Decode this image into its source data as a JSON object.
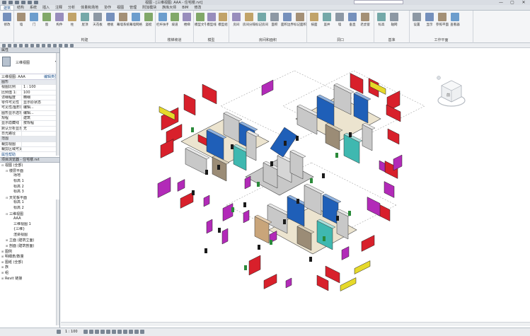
{
  "window": {
    "title": "视图 - [三维视图: AAA - 住宅楼.rvt]",
    "controls": [
      "—",
      "▢",
      "✕"
    ]
  },
  "tabs": [
    {
      "label": "建筑",
      "active": true
    },
    {
      "label": "结构"
    },
    {
      "label": "系统"
    },
    {
      "label": "插入"
    },
    {
      "label": "注释"
    },
    {
      "label": "分析"
    },
    {
      "label": "体量和场地"
    },
    {
      "label": "协作"
    },
    {
      "label": "视图"
    },
    {
      "label": "管理"
    },
    {
      "label": "附加模块"
    },
    {
      "label": "族库大师"
    },
    {
      "label": "BIM"
    },
    {
      "label": "修改"
    }
  ],
  "ribbon": {
    "panels": [
      {
        "title": "",
        "buttons": [
          {
            "label": "修改",
            "icon": "cursor-icon"
          }
        ]
      },
      {
        "title": "构建",
        "buttons": [
          {
            "label": "墙",
            "icon": "wall-icon"
          },
          {
            "label": "门",
            "icon": "door-icon"
          },
          {
            "label": "窗",
            "icon": "window-icon"
          },
          {
            "label": "构件",
            "icon": "component-icon"
          },
          {
            "label": "柱",
            "icon": "column-icon"
          },
          {
            "label": "屋顶",
            "icon": "roof-icon"
          },
          {
            "label": "天花板",
            "icon": "ceiling-icon"
          },
          {
            "label": "楼板",
            "icon": "floor-icon"
          },
          {
            "label": "幕墙系统",
            "icon": "curtain-system-icon"
          },
          {
            "label": "幕墙网格",
            "icon": "curtain-grid-icon"
          },
          {
            "label": "竖梃",
            "icon": "mullion-icon"
          }
        ]
      },
      {
        "title": "楼梯坡道",
        "buttons": [
          {
            "label": "栏杆扶手",
            "icon": "railing-icon"
          },
          {
            "label": "坡道",
            "icon": "ramp-icon"
          },
          {
            "label": "楼梯",
            "icon": "stair-icon"
          }
        ]
      },
      {
        "title": "模型",
        "buttons": [
          {
            "label": "模型文字",
            "icon": "model-text-icon"
          },
          {
            "label": "模型线",
            "icon": "model-line-icon"
          },
          {
            "label": "模型组",
            "icon": "model-group-icon"
          }
        ]
      },
      {
        "title": "房间和面积",
        "buttons": [
          {
            "label": "房间",
            "icon": "room-icon"
          },
          {
            "label": "房间分隔",
            "icon": "room-separator-icon"
          },
          {
            "label": "标记房间",
            "icon": "tag-room-icon"
          },
          {
            "label": "面积",
            "icon": "area-icon"
          },
          {
            "label": "面积边界",
            "icon": "area-boundary-icon"
          },
          {
            "label": "标记面积",
            "icon": "tag-area-icon"
          }
        ]
      },
      {
        "title": "洞口",
        "buttons": [
          {
            "label": "按面",
            "icon": "by-face-icon"
          },
          {
            "label": "竖井",
            "icon": "shaft-icon"
          },
          {
            "label": "墙",
            "icon": "wall-opening-icon"
          },
          {
            "label": "垂直",
            "icon": "vertical-opening-icon"
          },
          {
            "label": "老虎窗",
            "icon": "dormer-icon"
          }
        ]
      },
      {
        "title": "基准",
        "buttons": [
          {
            "label": "标高",
            "icon": "level-icon"
          },
          {
            "label": "轴网",
            "icon": "grid-icon"
          }
        ]
      },
      {
        "title": "工作平面",
        "buttons": [
          {
            "label": "设置",
            "icon": "set-plane-icon"
          },
          {
            "label": "显示",
            "icon": "show-plane-icon"
          },
          {
            "label": "参照平面",
            "icon": "ref-plane-icon"
          },
          {
            "label": "查看器",
            "icon": "viewer-icon"
          }
        ]
      }
    ]
  },
  "properties": {
    "header": "属性",
    "type_name": "三维视图",
    "filter_label": "三维视图: AAA",
    "edit_type": "编辑类型",
    "rows": [
      {
        "k": "图形",
        "v": "",
        "group": true
      },
      {
        "k": "视图比例",
        "v": "1 : 100"
      },
      {
        "k": "比例值 1:",
        "v": "100"
      },
      {
        "k": "详细程度",
        "v": "精细"
      },
      {
        "k": "零件可见性",
        "v": "显示原状态"
      },
      {
        "k": "可见性/图形替换",
        "v": "编辑..."
      },
      {
        "k": "图形显示选项",
        "v": "编辑..."
      },
      {
        "k": "规程",
        "v": "建筑"
      },
      {
        "k": "显示隐藏线",
        "v": "按规程"
      },
      {
        "k": "默认分析显示样式",
        "v": "无"
      },
      {
        "k": "日光路径",
        "v": ""
      },
      {
        "k": "范围",
        "v": "",
        "group": true
      },
      {
        "k": "裁剪视图",
        "v": ""
      },
      {
        "k": "裁剪区域可见",
        "v": ""
      }
    ],
    "apply": "属性帮助"
  },
  "browser": {
    "header": "项目浏览器 - 住宅楼.rvt",
    "items": [
      {
        "label": "视图 (全部)",
        "level": 0,
        "ex": "⊟"
      },
      {
        "label": "楼层平面",
        "level": 1,
        "ex": "⊟"
      },
      {
        "label": "场地",
        "level": 2,
        "ex": ""
      },
      {
        "label": "标高 1",
        "level": 2,
        "ex": ""
      },
      {
        "label": "标高 2",
        "level": 2,
        "ex": ""
      },
      {
        "label": "标高 3",
        "level": 2,
        "ex": ""
      },
      {
        "label": "天花板平面",
        "level": 1,
        "ex": "⊟"
      },
      {
        "label": "标高 1",
        "level": 2,
        "ex": ""
      },
      {
        "label": "标高 2",
        "level": 2,
        "ex": ""
      },
      {
        "label": "三维视图",
        "level": 1,
        "ex": "⊟"
      },
      {
        "label": "AAA",
        "level": 2,
        "ex": ""
      },
      {
        "label": "三维视图 1",
        "level": 2,
        "ex": ""
      },
      {
        "label": "{三维}",
        "level": 2,
        "ex": ""
      },
      {
        "label": "渲染视图",
        "level": 2,
        "ex": ""
      },
      {
        "label": "立面 (建筑立面)",
        "level": 1,
        "ex": "⊞"
      },
      {
        "label": "剖面 (建筑剖面)",
        "level": 1,
        "ex": "⊞"
      },
      {
        "label": "图例",
        "level": 0,
        "ex": "⊞"
      },
      {
        "label": "明细表/数量",
        "level": 0,
        "ex": "⊞"
      },
      {
        "label": "图纸 (全部)",
        "level": 0,
        "ex": "⊞"
      },
      {
        "label": "族",
        "level": 0,
        "ex": "⊞"
      },
      {
        "label": "组",
        "level": 0,
        "ex": "⊞"
      },
      {
        "label": "Revit 链接",
        "level": 0,
        "ex": "⊞"
      }
    ]
  },
  "status": {
    "scale": "1 : 100"
  },
  "viewcube": {
    "face": "前"
  },
  "colors": {
    "red": "#d8202b",
    "magenta": "#b22ab8",
    "yellow": "#e6d92a",
    "blue": "#1f5fb8",
    "teal": "#3fb8b0",
    "concrete": "#c8c8c8",
    "floor": "#ece4cf"
  }
}
